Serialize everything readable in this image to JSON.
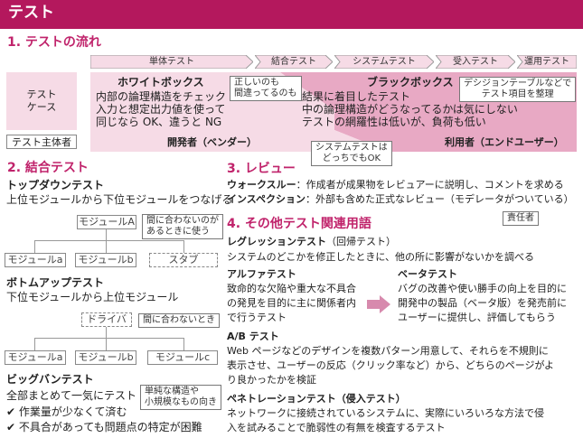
{
  "header": {
    "title": "テスト"
  },
  "flow": {
    "title": "1. テストの流れ",
    "phases": [
      "単体テスト",
      "結合テスト",
      "システムテスト",
      "受入テスト",
      "運用テスト"
    ],
    "test_case_label": [
      "テスト",
      "ケース"
    ],
    "whitebox": {
      "title": "ホワイトボックス",
      "lines": [
        "内部の論理構造をチェック",
        "入力と想定出力値を使って",
        "同じなら OK、違うと NG"
      ]
    },
    "callout_correct": [
      "正しいのも",
      "間違ってるのも"
    ],
    "blackbox": {
      "title": "ブラックボックス",
      "lines": [
        "結果に着目したテスト",
        "中の論理構造がどうなってるかは気にしない",
        "テストの網羅性は低いが、負荷も低い"
      ]
    },
    "callout_decision": [
      "デシジョンテーブルなどで",
      "テスト項目を整理"
    ],
    "actor_label": "テスト主体者",
    "developer": "開発者（ベンダー）",
    "user": "利用者（エンドユーザー）",
    "callout_system": [
      "システムテストは",
      "どっちでもOK"
    ]
  },
  "integration": {
    "title": "2. 結合テスト",
    "topdown": {
      "title": "トップダウンテスト",
      "desc": "上位モジュールから下位モジュールをつなげる",
      "moduleA": "モジュールA",
      "callout": [
        "間に合わないのが",
        "あるときに使う"
      ],
      "children": [
        "モジュールa",
        "モジュールb",
        "スタブ"
      ]
    },
    "bottomup": {
      "title": "ボトムアップテスト",
      "desc": "下位モジュールから上位モジュール",
      "driver": "ドライバ",
      "callout": "間に合わないとき",
      "children": [
        "モジュールa",
        "モジュールb",
        "モジュールc"
      ]
    },
    "bigbang": {
      "title": "ビッグバンテスト",
      "desc": "全部まとめて一気にテスト",
      "callout": [
        "単純な構造や",
        "小規模なもの向き"
      ],
      "pros": "✔ 作業量が少なくて済む",
      "cons": "✔ 不具合があっても問題点の特定が困難"
    }
  },
  "review": {
    "title": "3. レビュー",
    "walkthrough_term": "ウォークスルー",
    "walkthrough_desc": "：作成者が成果物をレビュアーに説明し、コメントを求める",
    "inspection_term": "インスペクション",
    "inspection_desc": "：外部も含めた正式なレビュー（モデレータがついている）",
    "responsible": "責任者"
  },
  "others": {
    "title": "4. その他テスト関連用語",
    "regression": {
      "title": "レグレッションテスト",
      "paren": "（回帰テスト）",
      "desc": "システムのどこかを修正したときに、他の所に影響がないかを調べる"
    },
    "alpha": {
      "title": "アルファテスト",
      "lines": [
        "致命的な欠陥や重大な不具合",
        "の発見を目的に主に関係者内",
        "で行うテスト"
      ]
    },
    "beta": {
      "title": "ベータテスト",
      "lines": [
        "バグの改善や使い勝手の向上を目的に",
        "開発中の製品（ベータ版）を発売前に",
        "ユーザーに提供し、評価してもらう"
      ]
    },
    "ab": {
      "title": "A/B テスト",
      "lines": [
        "Web ページなどのデザインを複数パターン用意して、それらを不規則に",
        "表示させ、ユーザーの反応（クリック率など）から、どちらのページがよ",
        "り良かったかを検証"
      ]
    },
    "penetration": {
      "title": "ペネトレーションテスト（侵入テスト）",
      "lines": [
        "ネットワークに接続されているシステムに、実際にいろいろな方法で侵",
        "入を試みることで脆弱性の有無を検査するテスト"
      ]
    }
  }
}
